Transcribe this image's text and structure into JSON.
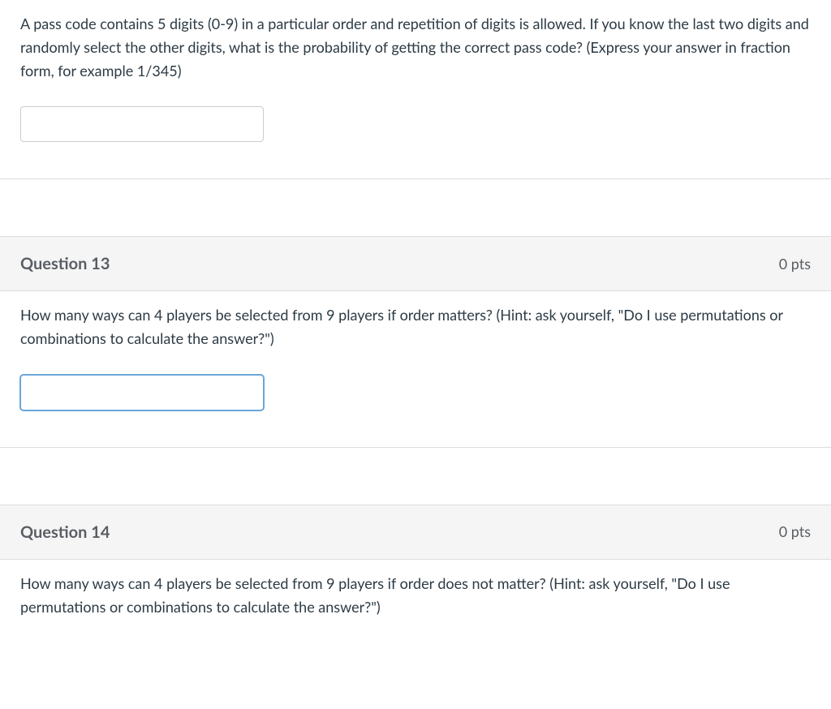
{
  "questions": {
    "q12": {
      "text": "A pass code contains 5 digits (0-9) in a particular order and repetition of digits is allowed.  If you know the last two digits and randomly select the other digits, what is the probability of getting the correct pass code? (Express your answer in fraction form, for example 1/345)",
      "value": ""
    },
    "q13": {
      "title": "Question 13",
      "points": "0 pts",
      "text": "How many ways can 4 players be selected from 9 players if order matters? (Hint: ask yourself, \"Do I use permutations or combinations to calculate the answer?\")",
      "value": ""
    },
    "q14": {
      "title": "Question 14",
      "points": "0 pts",
      "text": "How many ways can 4 players be selected from 9 players if order does not matter? (Hint: ask yourself, \"Do I use permutations or combinations to calculate the answer?\")",
      "value": ""
    }
  }
}
